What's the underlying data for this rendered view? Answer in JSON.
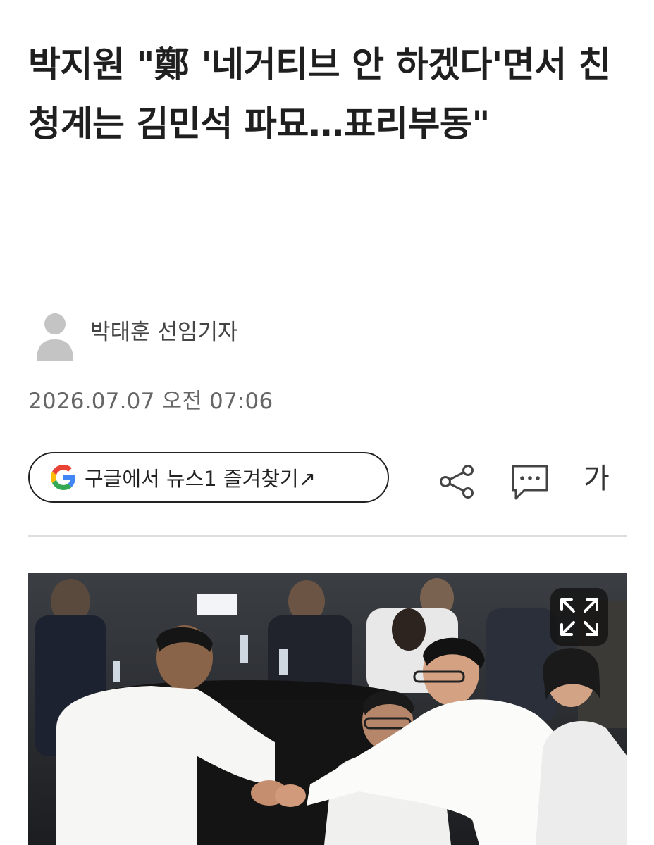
{
  "article": {
    "headline": "박지원 \"鄭 '네거티브 안 하겠다'면서 친청계는 김민석 파묘…표리부동\"",
    "reporter": "박태훈 선임기자",
    "datetime": "2026.07.07 오전 07:06"
  },
  "actions": {
    "google_follow_label": "구글에서 뉴스1 즐겨찾기↗",
    "google_icon": "google-g-icon",
    "share_icon": "share-icon",
    "comment_icon": "comment-icon",
    "font_size_label": "가"
  },
  "photo": {
    "description_icon": "expand-icon"
  },
  "colors": {
    "text": "#1f1f1f",
    "muted": "#666666",
    "divider": "#dddddd",
    "google_blue": "#4285F4",
    "google_red": "#EA4335",
    "google_yellow": "#FBBC05",
    "google_green": "#34A853"
  }
}
